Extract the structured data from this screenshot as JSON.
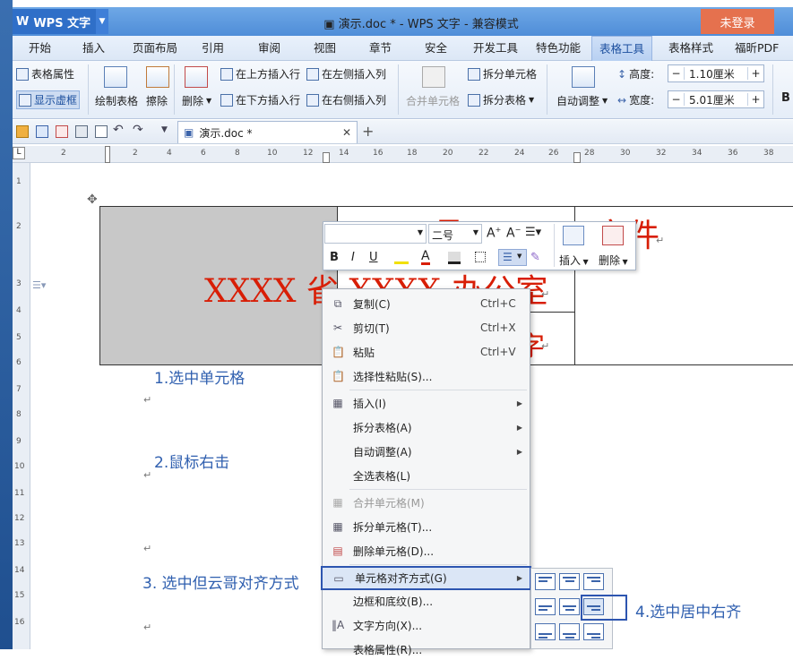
{
  "app": {
    "name": "WPS 文字",
    "window_title": "演示.doc * - WPS 文字 - 兼容模式",
    "login": "未登录"
  },
  "menus": [
    "开始",
    "插入",
    "页面布局",
    "引用",
    "审阅",
    "视图",
    "章节",
    "安全",
    "开发工具",
    "特色功能",
    "表格工具",
    "表格样式",
    "福昕PDF"
  ],
  "active_menu": "表格工具",
  "ribbon": {
    "table_props": "表格属性",
    "show_gridlines": "显示虚框",
    "draw_table": "绘制表格",
    "erase": "擦除",
    "delete": "删除",
    "insert_above": "在上方插入行",
    "insert_below": "在下方插入行",
    "insert_left": "在左侧插入列",
    "insert_right": "在右侧插入列",
    "merge_cells": "合并单元格",
    "split_cells": "拆分单元格",
    "split_table": "拆分表格",
    "autofit": "自动调整",
    "height_label": "高度:",
    "height_value": "1.10厘米",
    "width_label": "宽度:",
    "width_value": "5.01厘米",
    "bold": "B"
  },
  "doc_tab": {
    "name": "演示.doc *"
  },
  "ruler": {
    "h": [
      "2",
      "2",
      "4",
      "6",
      "8",
      "10",
      "12",
      "14",
      "16",
      "18",
      "20",
      "22",
      "24",
      "26",
      "28",
      "30",
      "32",
      "34",
      "36",
      "38"
    ],
    "v": [
      "1",
      "2",
      "3",
      "4",
      "5",
      "6",
      "7",
      "8",
      "9",
      "10",
      "11",
      "12",
      "13",
      "14",
      "15",
      "16"
    ]
  },
  "doc": {
    "cell_text": "XXXX 省 XXXX 办公室",
    "fragment_1": "文件",
    "fragment_2": "号",
    "fragment_3": "字"
  },
  "mini_toolbar": {
    "size": "二号",
    "insert": "插入",
    "delete": "删除",
    "bold": "B",
    "italic": "I",
    "underline": "U"
  },
  "context_menu": [
    {
      "label": "复制(C)",
      "shortcut": "Ctrl+C"
    },
    {
      "label": "剪切(T)",
      "shortcut": "Ctrl+X"
    },
    {
      "label": "粘贴",
      "shortcut": "Ctrl+V"
    },
    {
      "label": "选择性粘贴(S)...",
      "shortcut": ""
    },
    {
      "label": "插入(I)",
      "shortcut": ""
    },
    {
      "label": "拆分表格(A)",
      "shortcut": ""
    },
    {
      "label": "自动调整(A)",
      "shortcut": ""
    },
    {
      "label": "全选表格(L)",
      "shortcut": ""
    },
    {
      "label": "合并单元格(M)",
      "shortcut": ""
    },
    {
      "label": "拆分单元格(T)...",
      "shortcut": ""
    },
    {
      "label": "删除单元格(D)...",
      "shortcut": ""
    },
    {
      "label": "单元格对齐方式(G)",
      "shortcut": ""
    },
    {
      "label": "边框和底纹(B)...",
      "shortcut": ""
    },
    {
      "label": "文字方向(X)...",
      "shortcut": ""
    },
    {
      "label": "表格属性(R)...",
      "shortcut": ""
    }
  ],
  "annotations": {
    "step1": "1.选中单元格",
    "step2": "2.鼠标右击",
    "step3": "3. 选中但云哥对齐方式",
    "step4": "4.选中居中右齐"
  },
  "colors": {
    "title_bar": "#5a96dd",
    "login": "#e5714e",
    "red_text": "#d81e06",
    "annotation": "#2f5faf",
    "highlight": "#2d55b0"
  }
}
